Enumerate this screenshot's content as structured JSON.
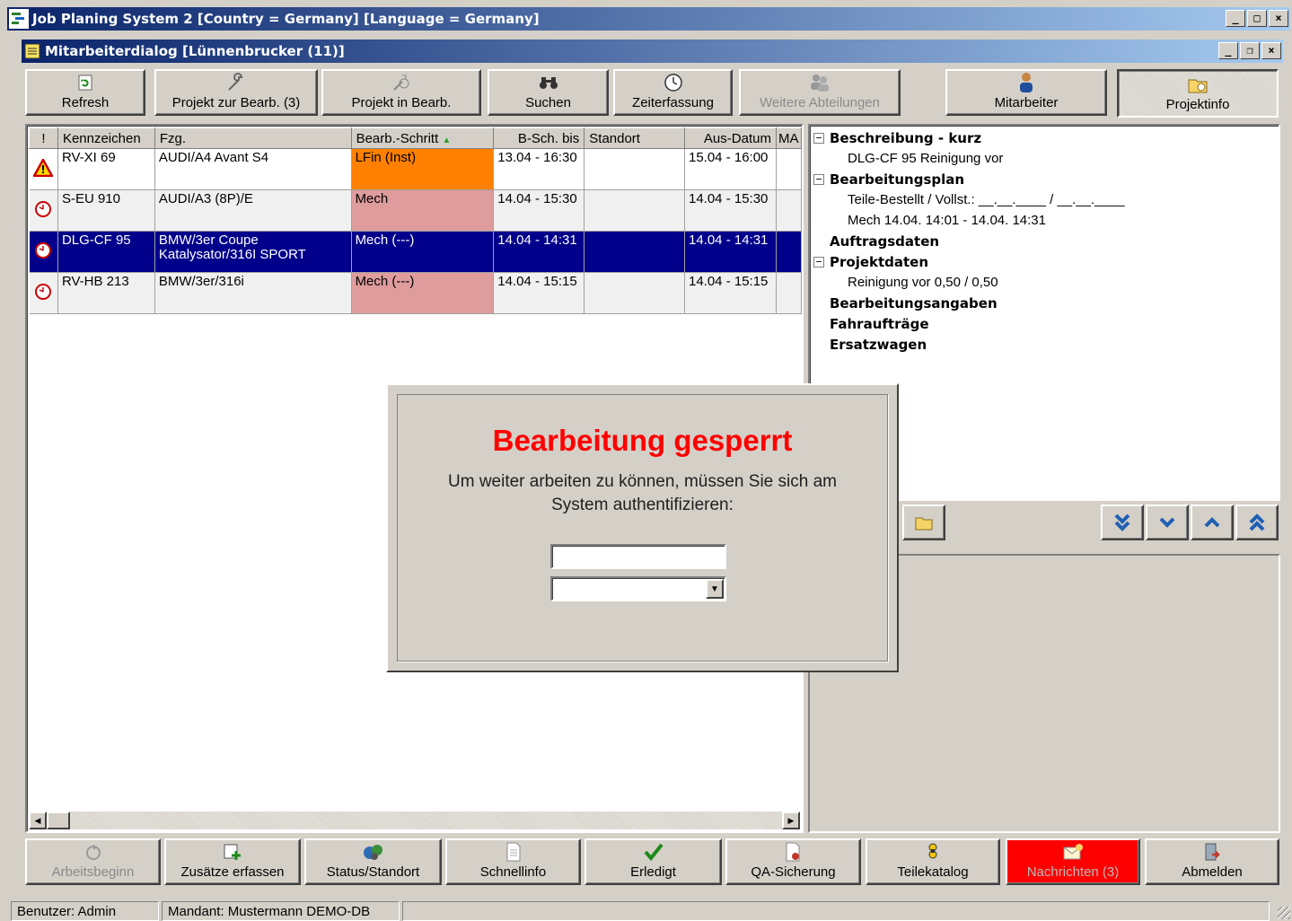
{
  "app": {
    "title": "Job Planing System 2 [Country = Germany] [Language = Germany]"
  },
  "child": {
    "title": "Mitarbeiterdialog [Lünnenbrucker (11)]"
  },
  "toolbar": [
    {
      "label": "Refresh",
      "icon": "refresh-icon"
    },
    {
      "label": "Projekt zur Bearb. (3)",
      "icon": "wrench-icon"
    },
    {
      "label": "Projekt in Bearb.",
      "icon": "wrench-busy-icon"
    },
    {
      "label": "Suchen",
      "icon": "binoculars-icon"
    },
    {
      "label": "Zeiterfassung",
      "icon": "clock-icon"
    },
    {
      "label": "Weitere Abteilungen",
      "icon": "users-icon"
    },
    {
      "label": "Mitarbeiter",
      "icon": "user-icon"
    },
    {
      "label": "Projektinfo",
      "icon": "project-info-icon"
    }
  ],
  "grid": {
    "columns": [
      "!",
      "Kennzeichen",
      "Fzg.",
      "Bearb.-Schritt",
      "B-Sch. bis",
      "Standort",
      "Aus-Datum",
      "MA"
    ],
    "rows": [
      {
        "status": "warning-icon",
        "kennzeichen": "RV-XI 69",
        "fzg": "AUDI/A4 Avant S4",
        "fzg2": "",
        "schritt": "LFin (Inst)",
        "bis": "13.04 - 16:30",
        "standort": "",
        "aus": "15.04 - 16:00",
        "color": "#ff8000"
      },
      {
        "status": "clock-icon",
        "kennzeichen": "S-EU 910",
        "fzg": "AUDI/A3 (8P)/E",
        "fzg2": "",
        "schritt": "Mech",
        "bis": "14.04 - 15:30",
        "standort": "",
        "aus": "14.04 - 15:30",
        "color": "#de9c9c"
      },
      {
        "status": "clock-icon",
        "kennzeichen": "DLG-CF 95",
        "fzg": "BMW/3er Coupe",
        "fzg2": "Katalysator/316I SPORT",
        "schritt": "Mech (---)",
        "bis": "14.04 - 14:31",
        "standort": "",
        "aus": "14.04 - 14:31",
        "color": "#00008b"
      },
      {
        "status": "clock-icon",
        "kennzeichen": "RV-HB 213",
        "fzg": "BMW/3er/316i",
        "fzg2": "",
        "schritt": "Mech (---)",
        "bis": "14.04 - 15:15",
        "standort": "",
        "aus": "14.04 - 15:15",
        "color": "#de9c9c"
      }
    ]
  },
  "tree": {
    "beschreibung": "Beschreibung - kurz",
    "beschreibung_text": "DLG-CF 95 Reinigung vor",
    "plan": "Bearbeitungsplan",
    "plan_teile": "Teile-Bestellt / Vollst.: __.__.____ / __.__.____",
    "plan_mech": "Mech 14.04. 14:01 - 14.04. 14:31",
    "auftrag": "Auftragsdaten",
    "projekt": "Projektdaten",
    "projekt_text": "Reinigung vor 0,50 / 0,50",
    "angaben": "Bearbeitungsangaben",
    "fahr": "Fahraufträge",
    "ersatz": "Ersatzwagen"
  },
  "modal": {
    "title": "Bearbeitung gesperrt",
    "message": "Um weiter arbeiten zu können, müssen Sie sich am System authentifizieren:",
    "password": "",
    "selected": ""
  },
  "bottom": [
    {
      "label": "Arbeitsbeginn",
      "icon": "start-work-icon"
    },
    {
      "label": "Zusätze erfassen",
      "icon": "add-extras-icon"
    },
    {
      "label": "Status/Standort",
      "icon": "status-icon"
    },
    {
      "label": "Schnellinfo",
      "icon": "document-icon"
    },
    {
      "label": "Erledigt",
      "icon": "checkmark-icon"
    },
    {
      "label": "QA-Sicherung",
      "icon": "qa-icon"
    },
    {
      "label": "Teilekatalog",
      "icon": "catalog-icon"
    },
    {
      "label": "Nachrichten (3)",
      "icon": "mail-icon"
    },
    {
      "label": "Abmelden",
      "icon": "logout-icon"
    }
  ],
  "status": {
    "user": "Benutzer: Admin",
    "mandant": "Mandant: Mustermann DEMO-DB"
  },
  "colors": {
    "selection": "#00008b",
    "lfin": "#ff8000",
    "mech": "#de9c9c",
    "alert": "#ff0000"
  }
}
